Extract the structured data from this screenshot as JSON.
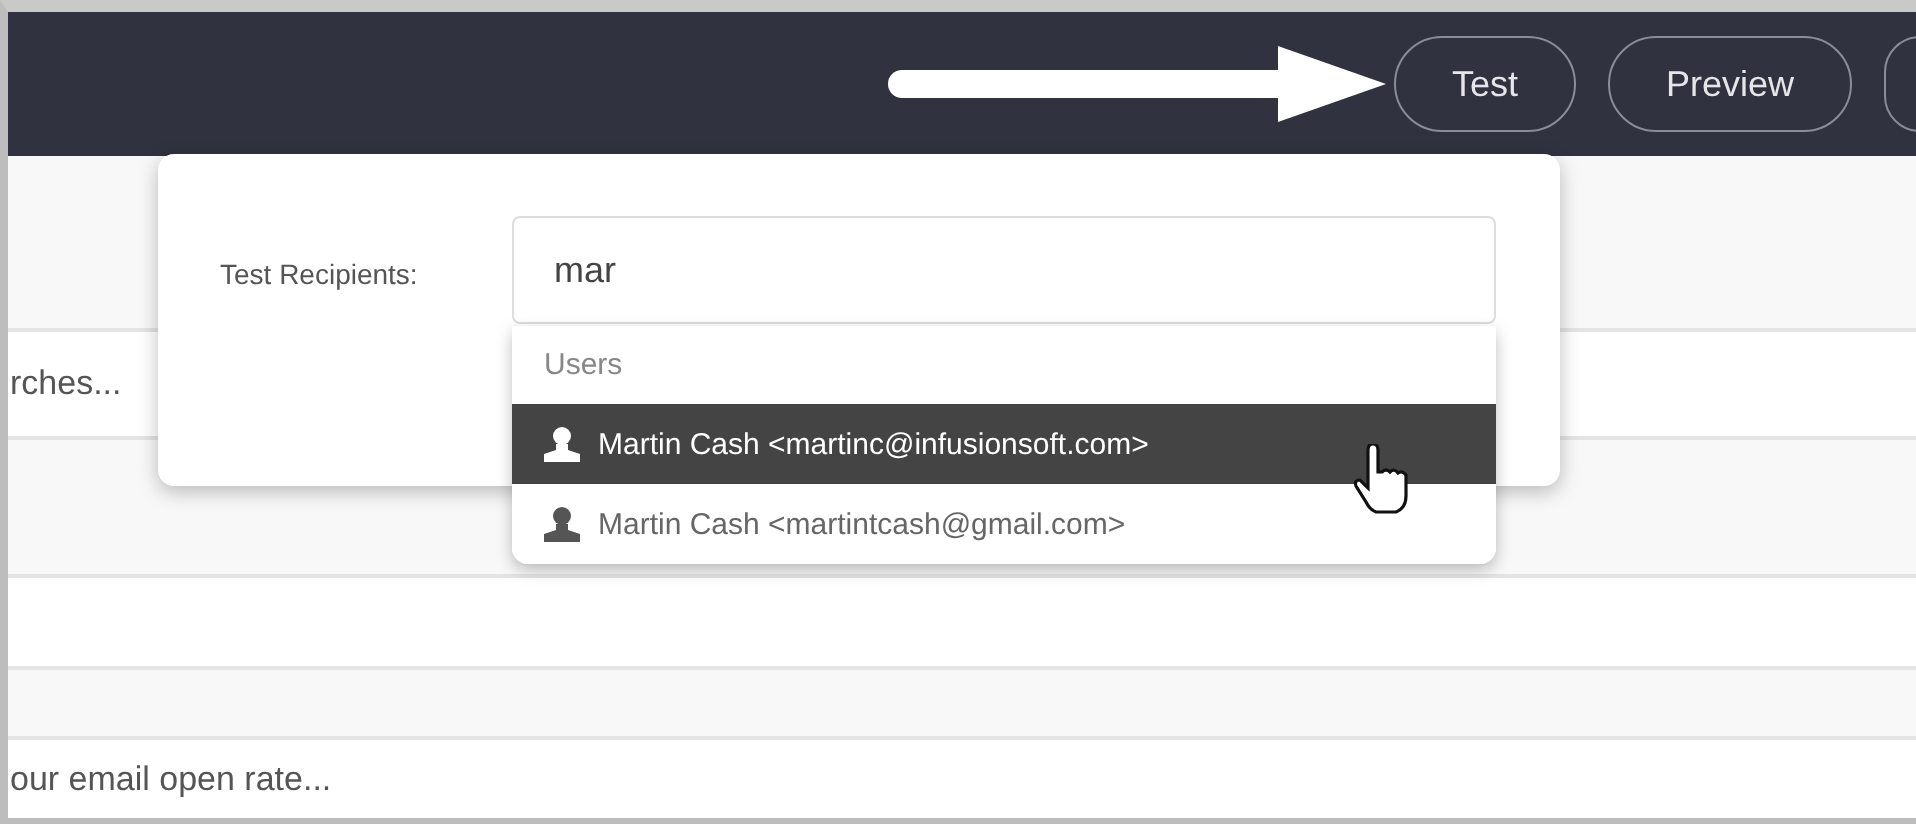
{
  "header": {
    "buttons": [
      {
        "label": "Test"
      },
      {
        "label": "Preview"
      }
    ]
  },
  "rows": [
    {
      "text": "rches..."
    },
    {
      "text": "our email open rate..."
    }
  ],
  "popup": {
    "label": "Test Recipients:",
    "field": {
      "value": "mar"
    },
    "dropdown": {
      "group": "Users",
      "items": [
        {
          "label": "Martin Cash <martinc@infusionsoft.com>",
          "selected": true
        },
        {
          "label": "Martin Cash <martintcash@gmail.com>",
          "selected": false
        }
      ]
    }
  }
}
